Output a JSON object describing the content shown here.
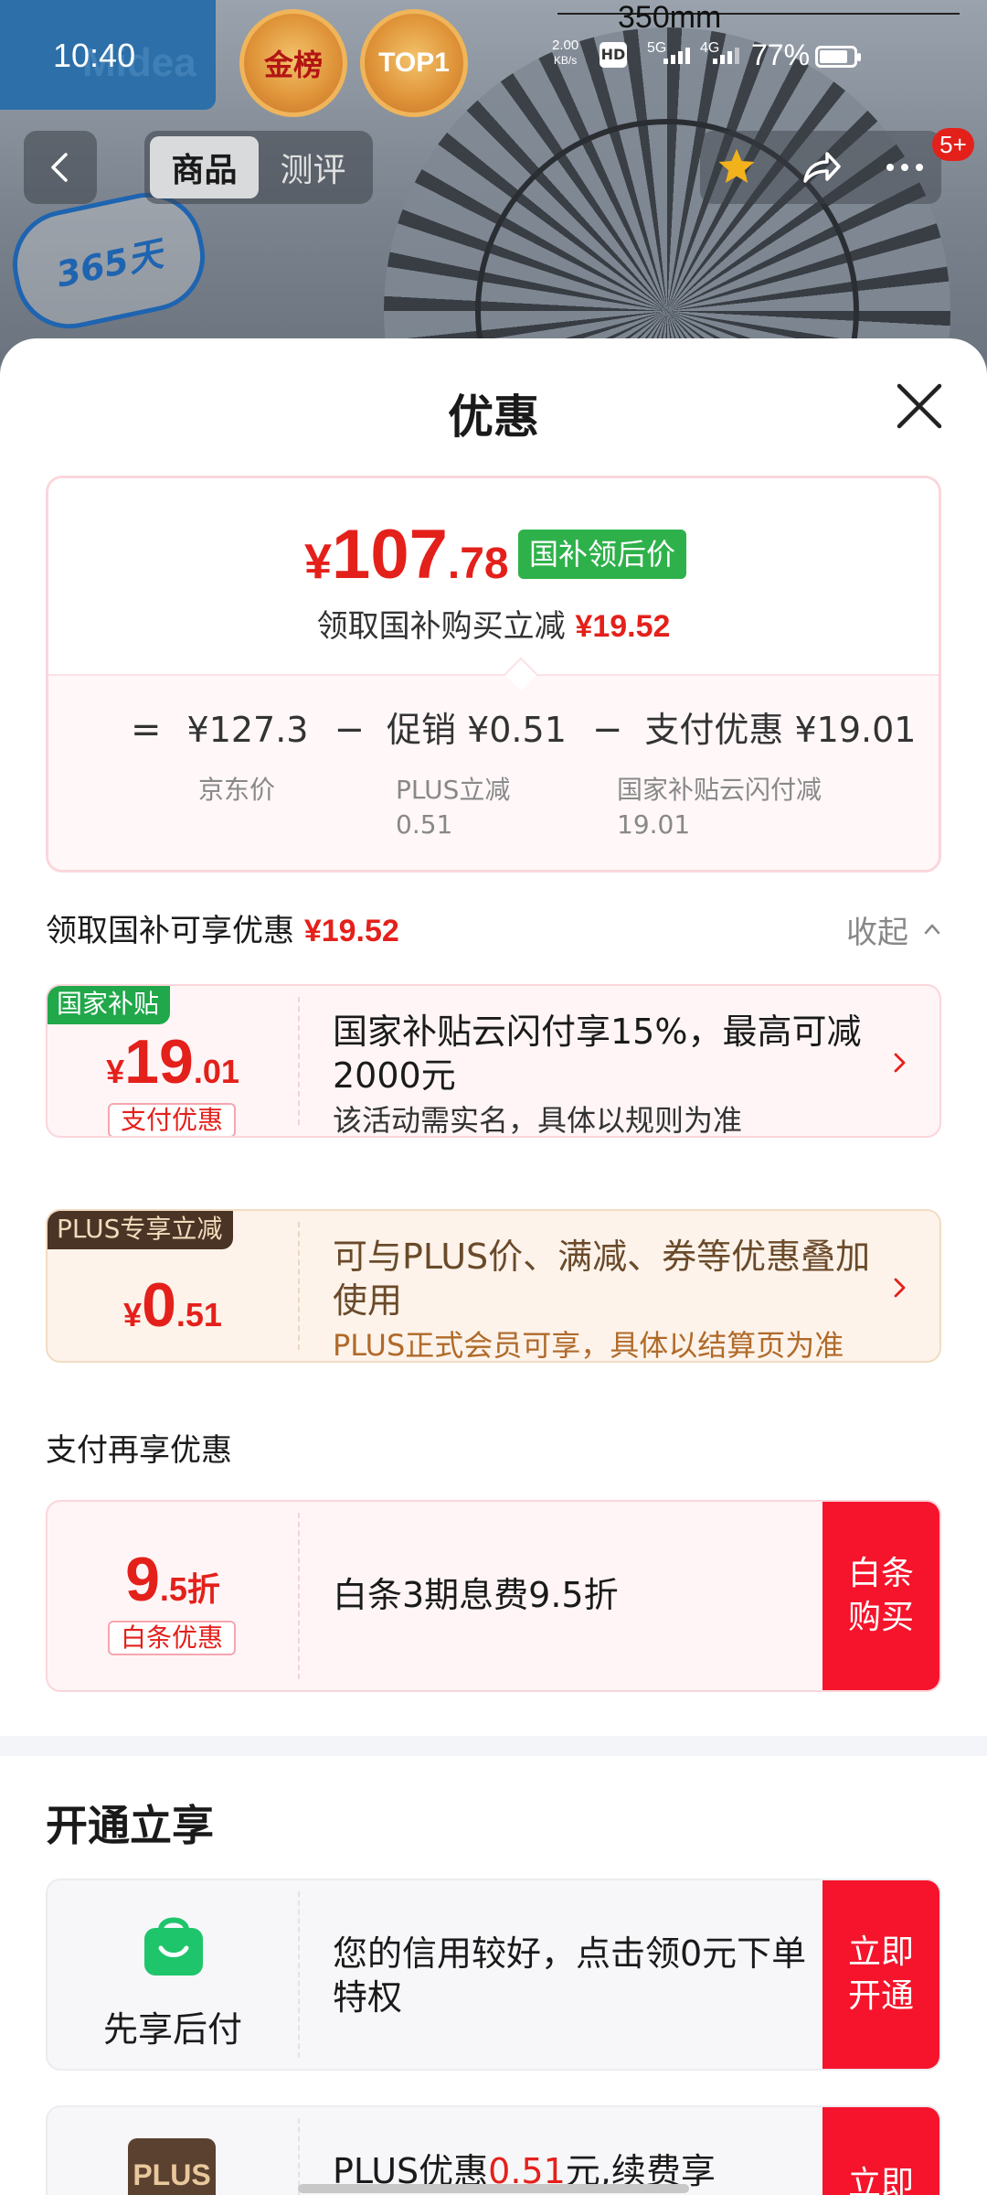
{
  "status_bar": {
    "time": "10:40",
    "net_speed_value": "2.00",
    "net_speed_unit": "KB/s",
    "hd": "HD",
    "sim1": "5G",
    "sim2": "4G",
    "battery": "77%"
  },
  "background": {
    "brand": "Midea",
    "medal_gold": "金榜",
    "medal_top": "TOP1",
    "dimension": "350mm",
    "badge_365": "365天"
  },
  "nav": {
    "tabs": [
      {
        "label": "商品",
        "active": true
      },
      {
        "label": "测评",
        "active": false
      }
    ],
    "badge": "5+"
  },
  "sheet": {
    "title": "优惠",
    "price": {
      "currency": "¥",
      "integer": "107",
      "decimal": ".78",
      "tag": "国补领后价",
      "sub_text": "领取国补购买立减",
      "sub_amount": "¥19.52"
    },
    "calc": {
      "equals": "=",
      "minus": "−",
      "base_value": "¥127.3",
      "base_label": "京东价",
      "promo_value": "促销 ¥0.51",
      "promo_label_1": "PLUS立减",
      "promo_label_2": "0.51",
      "pay_value": "支付优惠 ¥19.01",
      "pay_label_1": "国家补贴云闪付减",
      "pay_label_2": "19.01"
    },
    "section1": {
      "title": "领取国补可享优惠",
      "amount": "¥19.52",
      "collapse": "收起"
    },
    "coupons": [
      {
        "flag": "国家补贴",
        "currency": "¥",
        "integer": "19",
        "decimal": ".01",
        "tag": "支付优惠",
        "desc": "国家补贴云闪付享15%，最高可减2000元",
        "note": "该活动需实名，具体以规则为准"
      },
      {
        "flag": "PLUS专享立减",
        "currency": "¥",
        "integer": "0",
        "decimal": ".51",
        "desc": "可与PLUS价、满减、券等优惠叠加使用",
        "note": "PLUS正式会员可享，具体以结算页为准"
      }
    ],
    "section2": {
      "title": "支付再享优惠"
    },
    "baitiao": {
      "integer": "9",
      "decimal": ".5折",
      "tag": "白条优惠",
      "desc": "白条3期息费9.5折",
      "cta_1": "白条",
      "cta_2": "购买"
    },
    "open_section": {
      "title": "开通立享",
      "items": [
        {
          "name": "先享后付",
          "desc": "您的信用较好，点击领0元下单特权",
          "cta_1": "立即",
          "cta_2": "开通"
        },
        {
          "name": "PLUS",
          "desc_pre": "PLUS优惠",
          "desc_red": "0.51",
          "desc_post": "元,续费享",
          "cta_1": "立即"
        }
      ]
    }
  },
  "colors": {
    "accent_red": "#e4201b",
    "cta_red": "#f5142b",
    "subsidy_green": "#21a84a",
    "plus_brown": "#4a3425"
  }
}
